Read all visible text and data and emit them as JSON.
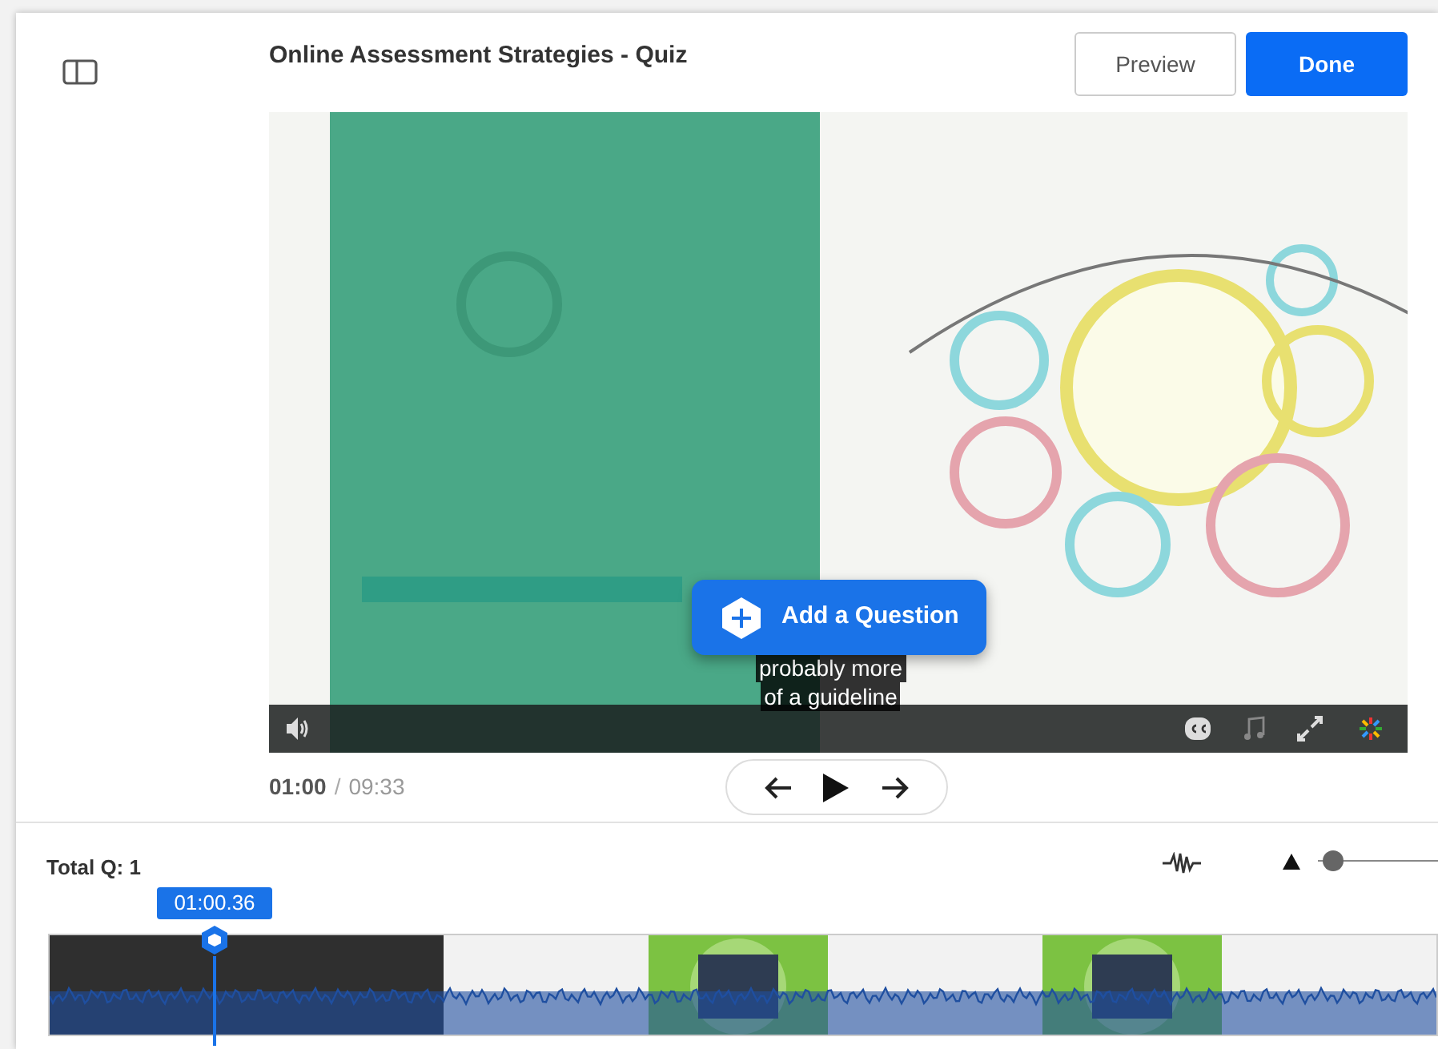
{
  "header": {
    "title": "Online Assessment Strategies - Quiz",
    "buttons": [
      {
        "label": "Preview",
        "kind": "secondary"
      },
      {
        "label": "Done",
        "kind": "primary"
      }
    ]
  },
  "video": {
    "add_button": "Add a Question",
    "captions": [
      "probably more",
      "of a guideline"
    ]
  },
  "playback": {
    "current_time": "01:00",
    "separator": "/",
    "duration": "09:33"
  },
  "timeline": {
    "total": "Total Q: 1",
    "playhead_time": "01:00.36",
    "zoom": {
      "level": 0.05
    }
  }
}
